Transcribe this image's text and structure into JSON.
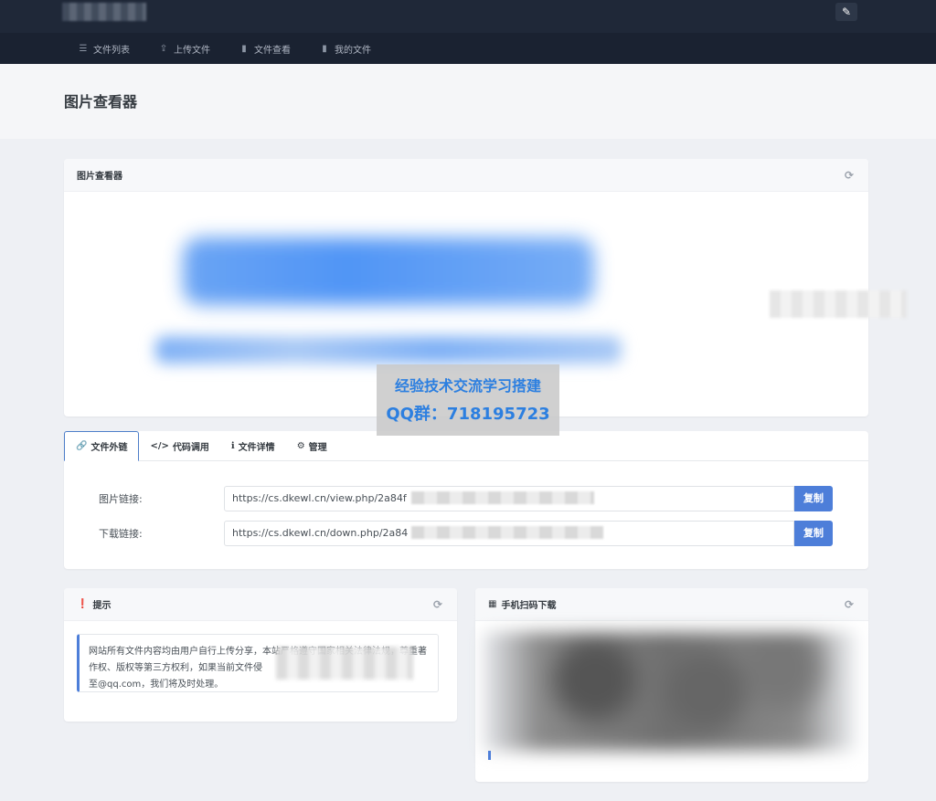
{
  "topbar": {
    "pen_icon": "brush-icon"
  },
  "nav": {
    "items": [
      {
        "label": "文件列表",
        "icon": "list-icon"
      },
      {
        "label": "上传文件",
        "icon": "upload-icon"
      },
      {
        "label": "文件查看",
        "icon": "file-icon"
      },
      {
        "label": "我的文件",
        "icon": "file-icon"
      }
    ]
  },
  "page": {
    "title": "图片查看器"
  },
  "viewer": {
    "header": "图片查看器"
  },
  "watermark": {
    "line1": "经验技术交流学习搭建",
    "line2": "QQ群：718195723"
  },
  "tabs": [
    {
      "label": "文件外链",
      "icon": "link-icon"
    },
    {
      "label": "代码调用",
      "icon": "code-icon"
    },
    {
      "label": "文件详情",
      "icon": "info-icon"
    },
    {
      "label": "管理",
      "icon": "gear-icon"
    }
  ],
  "links": {
    "image_label": "图片链接:",
    "image_value": "https://cs.dkewl.cn/view.php/2a84f",
    "download_label": "下载链接:",
    "download_value": "https://cs.dkewl.cn/down.php/2a84",
    "copy_label": "复制"
  },
  "notice": {
    "header": "提示",
    "text": "网站所有文件内容均由用户自行上传分享，本站严格遵守国家相关法律法规，尊重著作权、版权等第三方权利，如果当前文件侵",
    "text_end": "至@qq.com，我们将及时处理。"
  },
  "qr": {
    "header": "手机扫码下载"
  }
}
